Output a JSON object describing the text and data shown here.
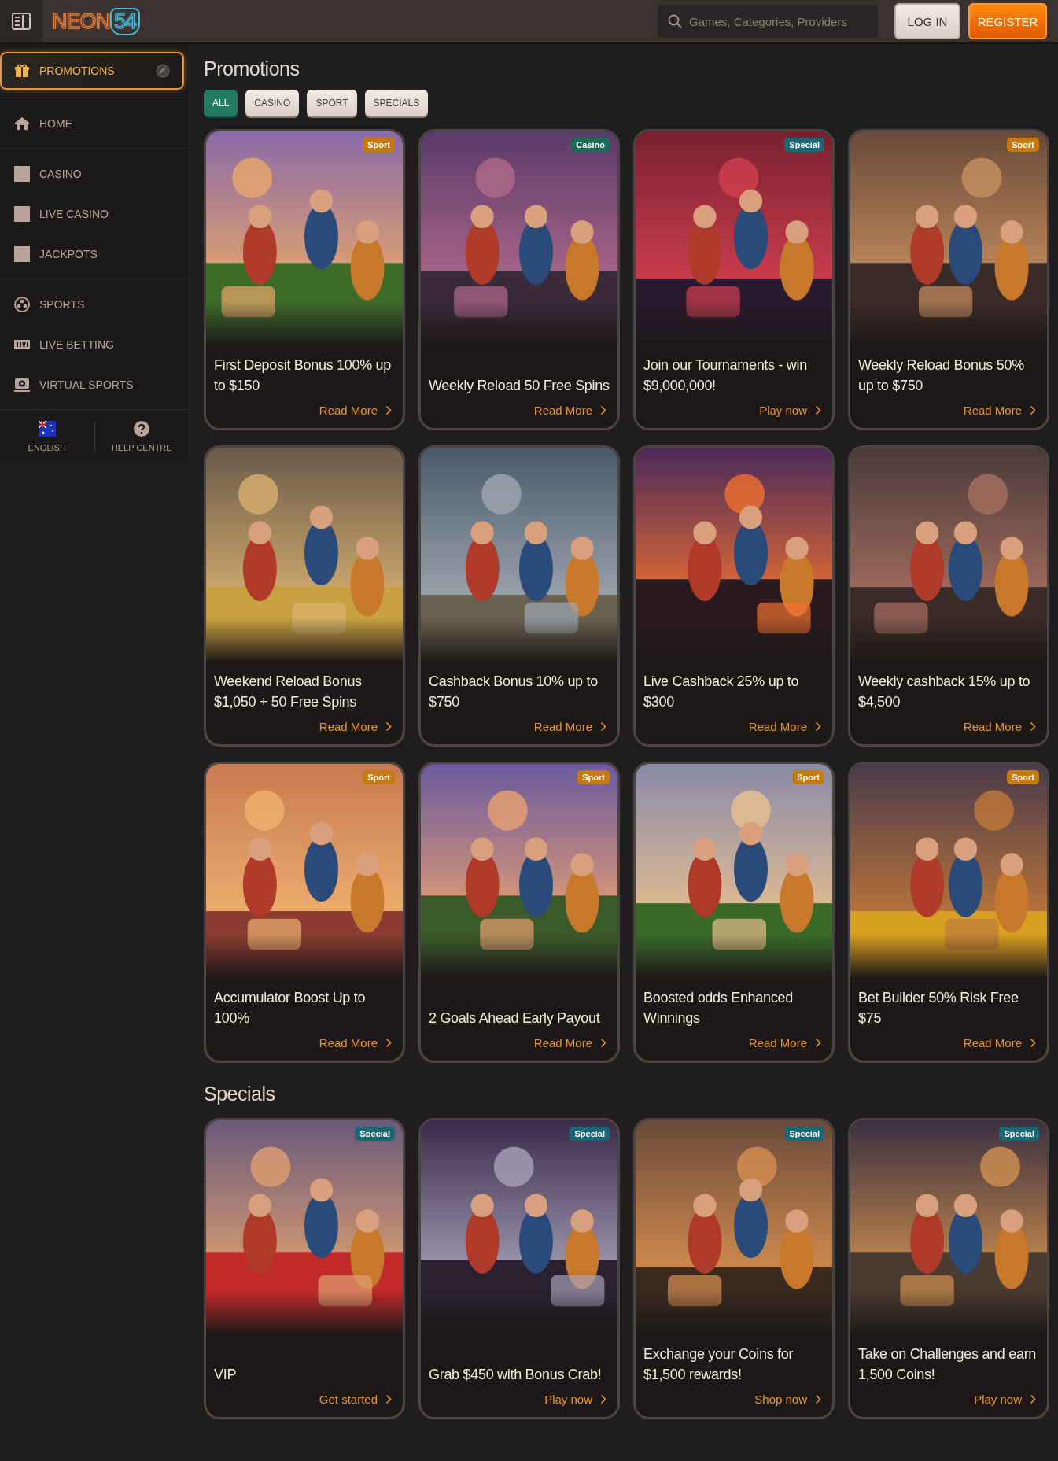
{
  "header": {
    "logo": {
      "word": "NEON",
      "number": "54"
    },
    "search": {
      "placeholder": "Games, Categories, Providers"
    },
    "buttons": [
      {
        "label": "LOG IN",
        "kind": "secondary"
      },
      {
        "label": "REGISTER",
        "kind": "primary"
      }
    ]
  },
  "sidebar": {
    "sections": [
      {
        "items": [
          {
            "label": "PROMOTIONS",
            "selected": true
          }
        ]
      },
      {
        "items": [
          {
            "label": "HOME",
            "selected": false
          }
        ]
      },
      {
        "items": [
          {
            "label": "CASINO",
            "selected": false
          },
          {
            "label": "LIVE CASINO",
            "selected": false
          },
          {
            "label": "JACKPOTS",
            "selected": false
          }
        ]
      },
      {
        "items": [
          {
            "label": "SPORTS",
            "selected": false
          },
          {
            "label": "LIVE BETTING",
            "selected": false
          },
          {
            "label": "VIRTUAL SPORTS",
            "selected": false
          }
        ]
      }
    ],
    "footer": [
      {
        "label": "ENGLISH"
      },
      {
        "label": "HELP CENTRE"
      }
    ]
  },
  "promotions": {
    "title": "Promotions",
    "filters": [
      {
        "label": "ALL",
        "selected": true
      },
      {
        "label": "CASINO",
        "selected": false
      },
      {
        "label": "SPORT",
        "selected": false
      },
      {
        "label": "SPECIALS",
        "selected": false
      }
    ],
    "cards": [
      {
        "title": "First Deposit Bonus 100% up to $150",
        "link": "Read More",
        "badge": {
          "label": "Sport",
          "color": "#c47a10"
        }
      },
      {
        "title": "Weekly Reload 50 Free Spins",
        "link": "Read More",
        "badge": {
          "label": "Casino",
          "color": "#1d6b57"
        }
      },
      {
        "title": "Join our Tournaments - win $9,000,000!",
        "link": "Play now",
        "badge": {
          "label": "Special",
          "color": "#1b6874"
        }
      },
      {
        "title": "Weekly Reload Bonus 50% up to $750",
        "link": "Read More",
        "badge": {
          "label": "Sport",
          "color": "#c47a10"
        }
      },
      {
        "title": "Weekend Reload Bonus $1,050 + 50 Free Spins",
        "link": "Read More"
      },
      {
        "title": "Cashback Bonus 10% up to $750",
        "link": "Read More"
      },
      {
        "title": "Live Cashback 25% up to $300",
        "link": "Read More"
      },
      {
        "title": "Weekly cashback 15% up to $4,500",
        "link": "Read More"
      },
      {
        "title": "Accumulator Boost Up to 100%",
        "link": "Read More",
        "badge": {
          "label": "Sport",
          "color": "#c47a10"
        }
      },
      {
        "title": "2 Goals Ahead Early Payout",
        "link": "Read More",
        "badge": {
          "label": "Sport",
          "color": "#c47a10"
        }
      },
      {
        "title": "Boosted odds Enhanced Winnings",
        "link": "Read More",
        "badge": {
          "label": "Sport",
          "color": "#c47a10"
        }
      },
      {
        "title": "Bet Builder 50% Risk Free $75",
        "link": "Read More",
        "badge": {
          "label": "Sport",
          "color": "#c47a10"
        }
      }
    ]
  },
  "specials": {
    "title": "Specials",
    "cards": [
      {
        "title": "VIP",
        "link": "Get started",
        "badge": {
          "label": "Special",
          "color": "#1b6874"
        }
      },
      {
        "title": "Grab $450 with Bonus Crab!",
        "link": "Play now",
        "badge": {
          "label": "Special",
          "color": "#1b6874"
        }
      },
      {
        "title": "Exchange your Coins for $1,500 rewards!",
        "link": "Shop now",
        "badge": {
          "label": "Special",
          "color": "#1b6874"
        }
      },
      {
        "title": "Take on Challenges and earn 1,500 Coins!",
        "link": "Play now",
        "badge": {
          "label": "Special",
          "color": "#1b6874"
        }
      }
    ]
  }
}
